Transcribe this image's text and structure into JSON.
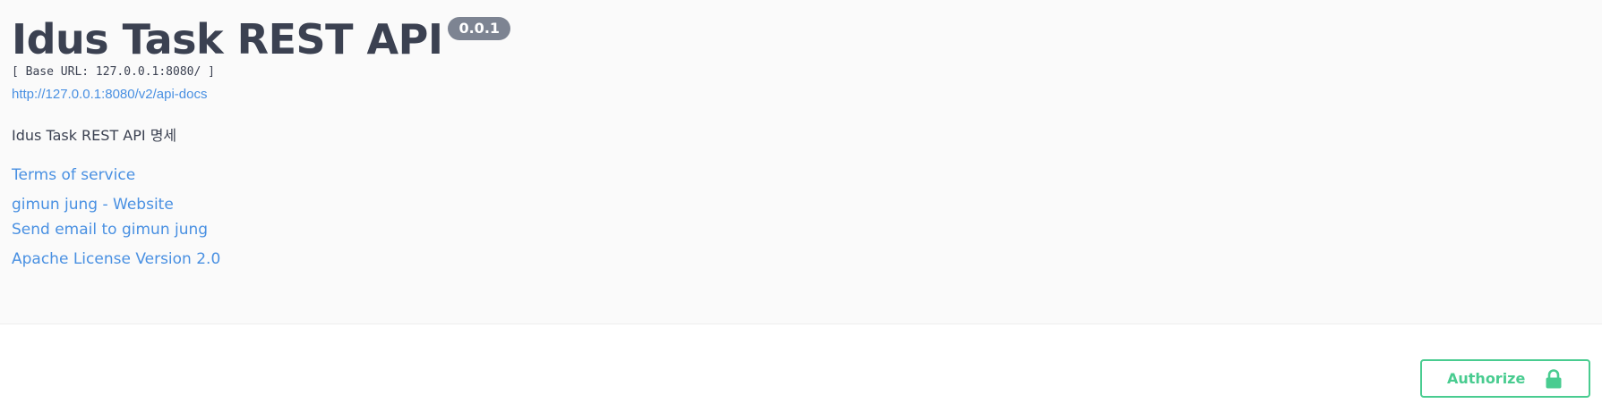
{
  "info": {
    "title": "Idus Task REST API",
    "version": "0.0.1",
    "base_url": "[ Base URL: 127.0.0.1:8080/ ]",
    "api_docs_link": "http://127.0.0.1:8080/v2/api-docs",
    "description": "Idus Task REST API 명세",
    "links": {
      "terms": "Terms of service",
      "website": "gimun jung - Website",
      "email": "Send email to gimun jung",
      "license": "Apache License Version 2.0"
    }
  },
  "auth": {
    "button_label": "Authorize",
    "icon": "lock-icon"
  },
  "colors": {
    "accent_green": "#49cc90",
    "link_blue": "#4990e2",
    "text": "#3b4151",
    "badge": "#7d8492",
    "info_bg": "#fafafa"
  }
}
